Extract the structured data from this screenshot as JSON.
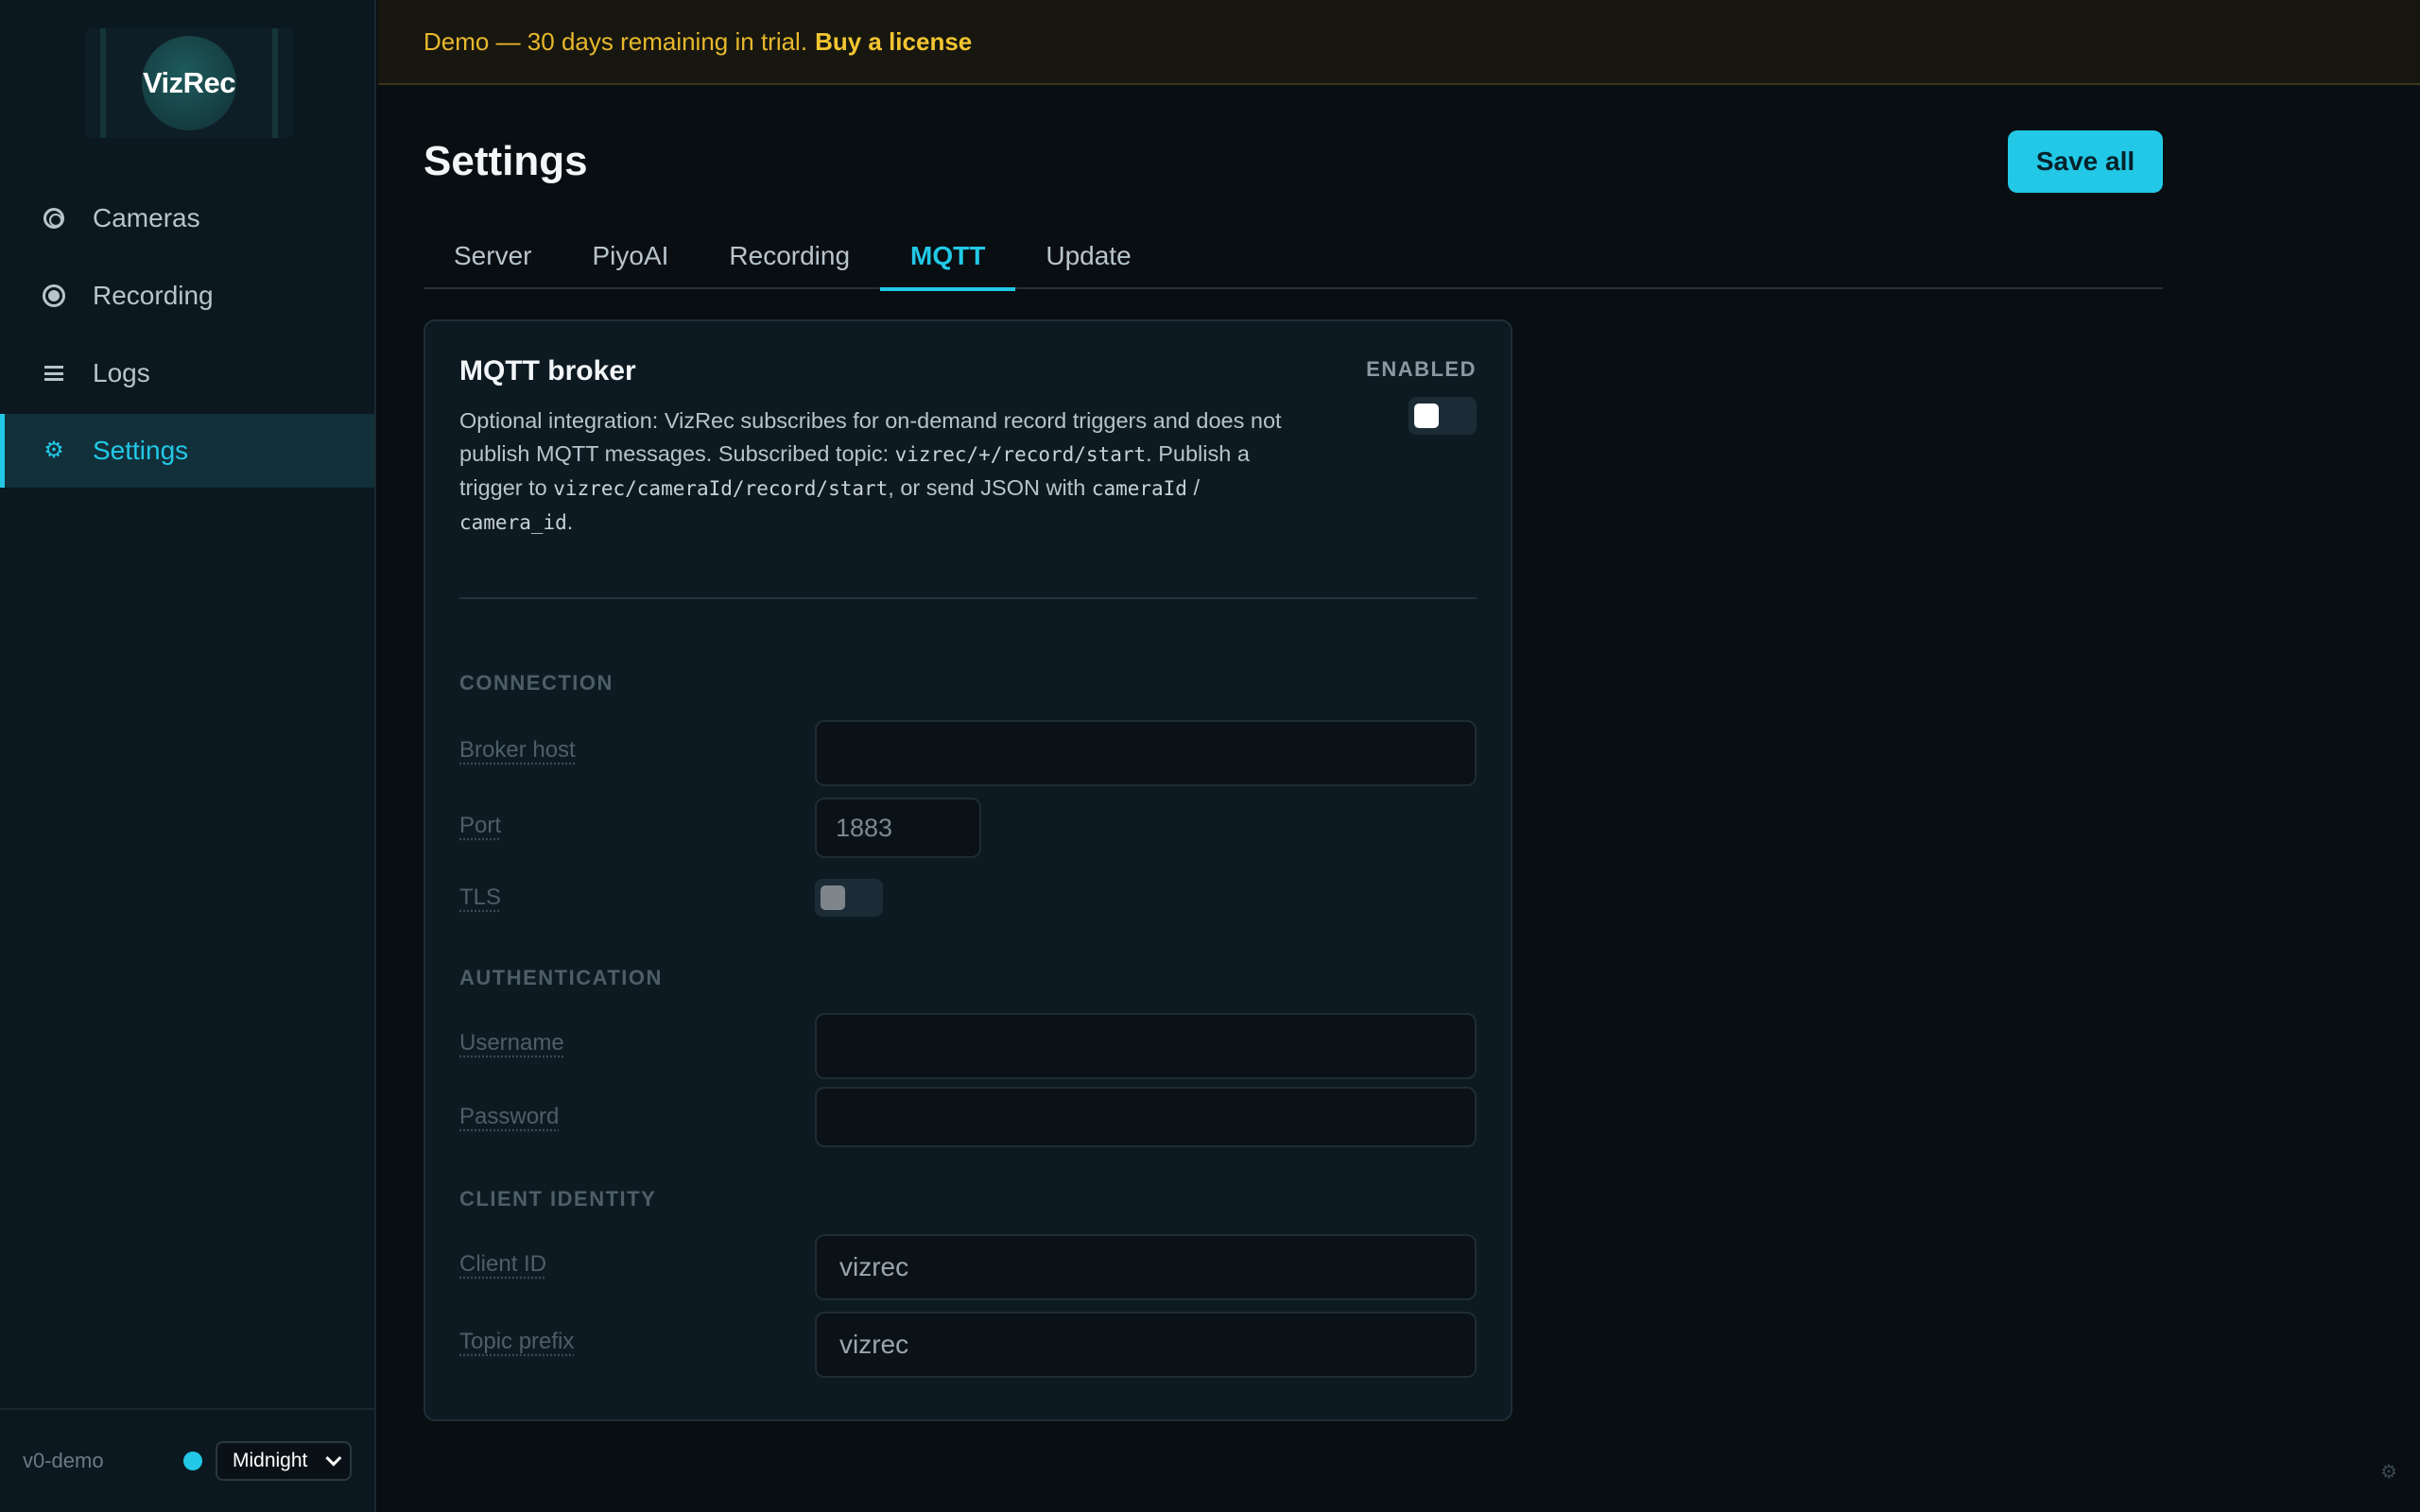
{
  "banner": {
    "text": "Demo — 30 days remaining in trial.",
    "link": "Buy a license"
  },
  "sidebar": {
    "logo_text": "VizRec",
    "items": [
      {
        "label": "Cameras",
        "icon": "camera-ring-icon"
      },
      {
        "label": "Recording",
        "icon": "record-dot-icon"
      },
      {
        "label": "Logs",
        "icon": "list-lines-icon"
      },
      {
        "label": "Settings",
        "icon": "gear-icon",
        "active": true
      }
    ],
    "footer": {
      "version": "v0-demo",
      "theme": "Midnight"
    }
  },
  "page": {
    "title": "Settings",
    "save_label": "Save all",
    "tabs": [
      {
        "label": "Server"
      },
      {
        "label": "PiyoAI"
      },
      {
        "label": "Recording"
      },
      {
        "label": "MQTT",
        "active": true
      },
      {
        "label": "Update"
      }
    ]
  },
  "mqtt": {
    "title": "MQTT broker",
    "enabled_label": "ENABLED",
    "enabled": false,
    "desc": {
      "p1": "Optional integration: VizRec subscribes for on-demand record triggers and does not publish MQTT messages. Subscribed topic: ",
      "topic": "vizrec/+/record/start",
      "p2": ". Publish a trigger to ",
      "trigger": "vizrec/cameraId/record/start",
      "p3": ", or send JSON with ",
      "key1": "cameraId",
      "p4": " / ",
      "key2": "camera_id",
      "p5": "."
    },
    "connection": {
      "heading": "CONNECTION",
      "broker_host_label": "Broker host",
      "broker_host_value": "",
      "port_label": "Port",
      "port_value": "1883",
      "tls_label": "TLS",
      "tls": false
    },
    "authentication": {
      "heading": "AUTHENTICATION",
      "username_label": "Username",
      "username_value": "",
      "password_label": "Password",
      "password_value": ""
    },
    "client_identity": {
      "heading": "CLIENT IDENTITY",
      "client_id_label": "Client ID",
      "client_id_value": "vizrec",
      "topic_prefix_label": "Topic prefix",
      "topic_prefix_value": "vizrec"
    }
  },
  "colors": {
    "accent": "#22c8e6",
    "banner_text": "#e8b82c",
    "background": "#090e12",
    "sidebar": "#0c1820"
  }
}
